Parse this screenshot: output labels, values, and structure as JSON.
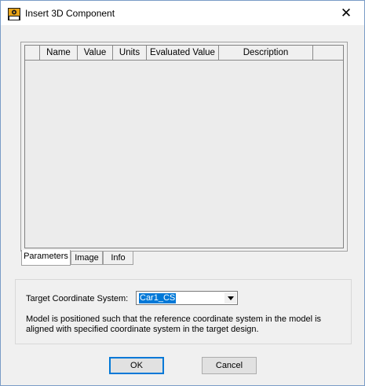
{
  "window": {
    "title": "Insert 3D Component",
    "close_glyph": "✕",
    "icon": "ansys-app-icon"
  },
  "grid": {
    "columns": [
      "",
      "Name",
      "Value",
      "Units",
      "Evaluated Value",
      "Description",
      ""
    ],
    "rows": []
  },
  "tabs": [
    {
      "label": "Parameters",
      "active": true
    },
    {
      "label": "Image",
      "active": false
    },
    {
      "label": "Info",
      "active": false
    }
  ],
  "target": {
    "label": "Target Coordinate System:",
    "selected": "Car1_CS",
    "description": "Model is positioned such that the reference coordinate system in the model is aligned with specified coordinate system in the target design."
  },
  "buttons": {
    "ok": "OK",
    "cancel": "Cancel"
  }
}
